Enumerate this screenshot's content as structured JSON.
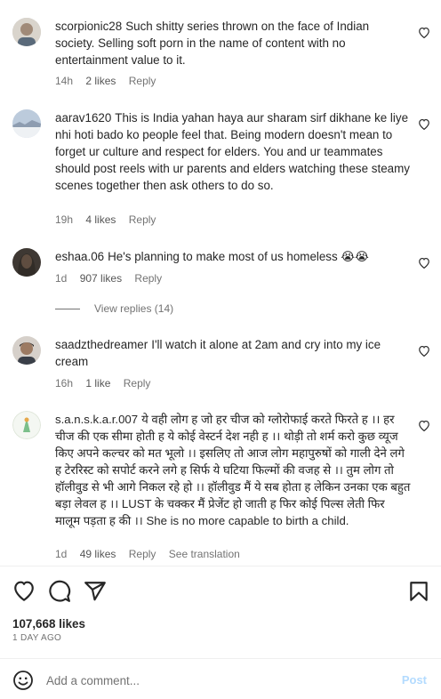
{
  "comments": [
    {
      "username": "scorpionic28",
      "text": "Such shitty series thrown on the face of Indian society. Selling soft porn in the name of content with no entertainment value to it.",
      "time": "14h",
      "likes": "2 likes",
      "reply": "Reply",
      "avatar_color": "#8a8a8a"
    },
    {
      "username": "aarav1620",
      "text": "This is India yahan haya aur sharam sirf dikhane ke liye nhi hoti bado ko people feel that. Being modern doesn't mean to forget ur culture and respect for elders. You and ur teammates should post reels with ur parents and elders watching these steamy scenes together then ask others to do so.",
      "time": "19h",
      "likes": "4 likes",
      "reply": "Reply",
      "avatar_color": "#9fb3c8"
    },
    {
      "username": "eshaa.06",
      "text": "He's planning to make most of us homeless 😭😭",
      "time": "1d",
      "likes": "907 likes",
      "reply": "Reply",
      "avatar_color": "#5a5148"
    },
    {
      "username": "saadzthedreamer",
      "text": "I'll watch it alone at 2am and cry into my ice cream",
      "time": "16h",
      "likes": "1 like",
      "reply": "Reply",
      "avatar_color": "#6b6260"
    },
    {
      "username": "s.a.n.s.k.a.r.007",
      "text": "ये वही लोग ह जो हर चीज को ग्लोरोफाई करते फिरते ह ।। हर चीज की एक सीमा होती ह ये कोई वेस्टर्न देश नही ह ।। थोड़ी तो शर्म करो कुछ व्यूज किए अपने कल्चर को मत भूलो ।। इसलिए तो आज लोग महापुरुषों को गाली देने लगे ह टेररिस्ट को सपोर्ट करने लगे ह सिर्फ ये घटिया फिल्मों की वजह से ।। तुम लोग तो हॉलीवुड से भी आगे निकल रहे हो ।। हॉलीवुड मैं ये सब होता ह लेकिन उनका एक बहुत बड़ा लेवल ह ।। LUST के चक्कर मैं प्रेजेंट हो जाती ह फिर कोई पिल्स लेती फिर मालूम पड़ता ह की ।। She is no more capable to birth a child.",
      "time": "1d",
      "likes": "49 likes",
      "reply": "Reply",
      "see_translation": "See translation",
      "avatar_color": "#d8e8d0"
    }
  ],
  "view_replies": "View replies (14)",
  "post": {
    "likes_count": "107,668 likes",
    "date": "1 DAY AGO"
  },
  "add_comment": {
    "placeholder": "Add a comment...",
    "post_label": "Post"
  }
}
